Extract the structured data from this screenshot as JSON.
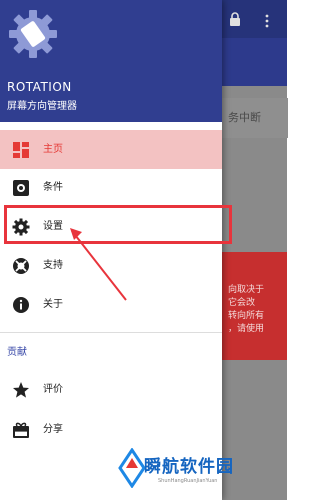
{
  "app": {
    "name": "ROTATION",
    "subtitle": "屏幕方向管理器"
  },
  "background": {
    "status_text": "务中断",
    "red_card_text": "向取决于\n它会改\n转向所有\n，请使用"
  },
  "menu": {
    "items": [
      {
        "label": "主页",
        "icon": "home-grid-icon",
        "active": true
      },
      {
        "label": "条件",
        "icon": "condition-icon",
        "active": false
      },
      {
        "label": "设置",
        "icon": "gear-icon",
        "active": false
      },
      {
        "label": "支持",
        "icon": "lifebuoy-icon",
        "active": false
      },
      {
        "label": "关于",
        "icon": "info-icon",
        "active": false
      }
    ],
    "section_title": "贡献",
    "section_items": [
      {
        "label": "评价",
        "icon": "star-icon"
      },
      {
        "label": "分享",
        "icon": "gift-icon"
      }
    ]
  },
  "watermark": {
    "title": "瞬航软件园",
    "subtitle": "ShunHangRuanJianYuan"
  },
  "colors": {
    "header": "#303e90",
    "accent_red": "#e53935",
    "active_bg": "#f3c2c2",
    "annotation": "#e8343c"
  }
}
